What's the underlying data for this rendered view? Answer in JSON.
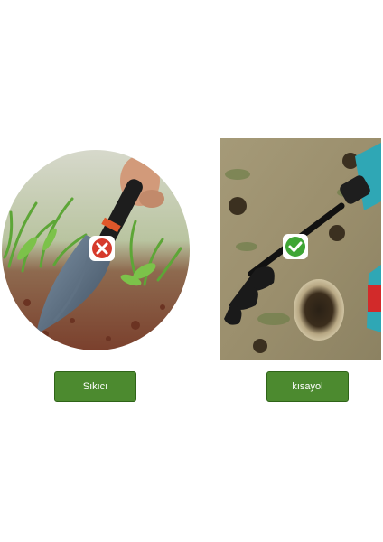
{
  "left_panel": {
    "label": "Sıkıcı",
    "badge_icon": "cross-icon",
    "badge_color": "#d63a2c"
  },
  "right_panel": {
    "label": "kısayol",
    "badge_icon": "check-icon",
    "badge_color": "#3fa535"
  },
  "colors": {
    "button_green": "#4c8a2f",
    "soil": "#8b4a33",
    "grass": "#6ab23e"
  }
}
